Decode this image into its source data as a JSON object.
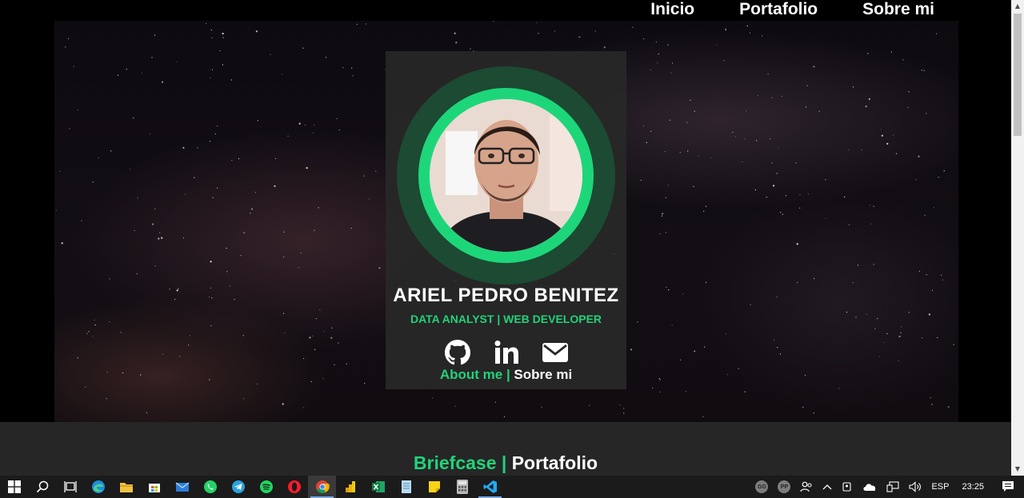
{
  "nav": {
    "inicio": "Inicio",
    "portafolio": "Portafolio",
    "sobre_mi": "Sobre mi"
  },
  "profile": {
    "name": "ARIEL PEDRO BENITEZ",
    "role": "DATA ANALYST | WEB DEVELOPER",
    "socials": [
      "github-icon",
      "linkedin-icon",
      "mail-icon"
    ],
    "about_en": "About me",
    "about_sep": " | ",
    "about_es": "Sobre mi"
  },
  "portfolio_section": {
    "title_en": "Briefcase",
    "title_sep": " | ",
    "title_es": "Portafolio"
  },
  "colors": {
    "accent": "#22d27a",
    "ring_dark": "#1c4a32",
    "card_bg": "#282828",
    "section_bg": "#262626",
    "taskbar_bg": "#1b1b1b"
  },
  "taskbar": {
    "apps": [
      "windows-start-icon",
      "search-icon",
      "task-view-icon",
      "edge-icon",
      "file-explorer-icon",
      "store-icon",
      "mail-icon",
      "whatsapp-icon",
      "telegram-icon",
      "spotify-icon",
      "opera-icon",
      "chrome-icon",
      "power-bi-icon",
      "excel-icon",
      "notepad-icon",
      "sticky-notes-icon",
      "calculator-icon",
      "vscode-icon"
    ],
    "active_app": "chrome-icon",
    "tray": {
      "badge1": "GG",
      "badge2": "PP",
      "language": "ESP",
      "time": "23:25"
    }
  }
}
